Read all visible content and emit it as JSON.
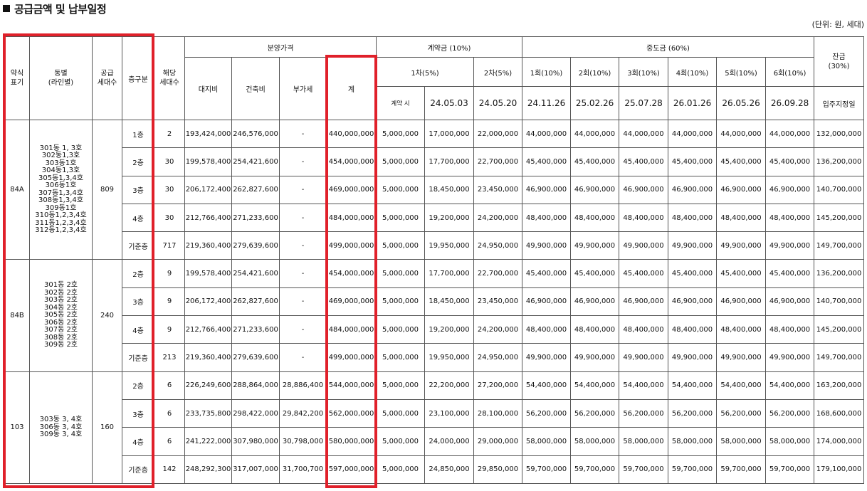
{
  "title": "공급금액 및 납부일정",
  "unit_note": "(단위: 원, 세대)",
  "headers": {
    "type": "약식\n표기",
    "dong": "동별\n(라인별)",
    "supply": "공급\n세대수",
    "floor": "층구분",
    "units": "해당\n세대수",
    "price": "분양가격",
    "land": "대지비",
    "building": "건축비",
    "vat": "부가세",
    "total": "계",
    "contract": "계약금 (10%)",
    "c1": "1차(5%)",
    "c2": "2차(5%)",
    "c1_when": "계약 시",
    "c1_date": "24.05.03",
    "c2_date": "24.05.20",
    "middle": "중도금 (60%)",
    "m1": "1회(10%)",
    "m2": "2회(10%)",
    "m3": "3회(10%)",
    "m4": "4회(10%)",
    "m5": "5회(10%)",
    "m6": "6회(10%)",
    "m1_date": "24.11.26",
    "m2_date": "25.02.26",
    "m3_date": "25.07.28",
    "m4_date": "26.01.26",
    "m5_date": "26.05.26",
    "m6_date": "26.09.28",
    "balance": "잔금\n(30%)",
    "balance_date": "입주지정일"
  },
  "groups": [
    {
      "type": "84A",
      "dong": "301동 1, 3호\n302동1,3호\n303동1호\n304동1,3호\n305동1,3,4호\n306동1호\n307동1,3,4호\n308동1,3,4호\n309동1호\n310동1,2,3,4호\n311동1,2,3,4호\n312동1,2,3,4호",
      "supply": "809",
      "rows": [
        {
          "floor": "1층",
          "units": "2",
          "land": "193,424,000",
          "building": "246,576,000",
          "vat": "-",
          "total": "440,000,000",
          "c1": "5,000,000",
          "c1b": "17,000,000",
          "c2": "22,000,000",
          "m": "44,000,000",
          "bal": "132,000,000"
        },
        {
          "floor": "2층",
          "units": "30",
          "land": "199,578,400",
          "building": "254,421,600",
          "vat": "-",
          "total": "454,000,000",
          "c1": "5,000,000",
          "c1b": "17,700,000",
          "c2": "22,700,000",
          "m": "45,400,000",
          "bal": "136,200,000"
        },
        {
          "floor": "3층",
          "units": "30",
          "land": "206,172,400",
          "building": "262,827,600",
          "vat": "-",
          "total": "469,000,000",
          "c1": "5,000,000",
          "c1b": "18,450,000",
          "c2": "23,450,000",
          "m": "46,900,000",
          "bal": "140,700,000"
        },
        {
          "floor": "4층",
          "units": "30",
          "land": "212,766,400",
          "building": "271,233,600",
          "vat": "-",
          "total": "484,000,000",
          "c1": "5,000,000",
          "c1b": "19,200,000",
          "c2": "24,200,000",
          "m": "48,400,000",
          "bal": "145,200,000"
        },
        {
          "floor": "기준층",
          "units": "717",
          "land": "219,360,400",
          "building": "279,639,600",
          "vat": "-",
          "total": "499,000,000",
          "c1": "5,000,000",
          "c1b": "19,950,000",
          "c2": "24,950,000",
          "m": "49,900,000",
          "bal": "149,700,000"
        }
      ]
    },
    {
      "type": "84B",
      "dong": "301동 2호\n302동 2호\n303동 2호\n304동 2호\n305동 2호\n306동 2호\n307동 2호\n308동 2호\n309동 2호",
      "supply": "240",
      "rows": [
        {
          "floor": "2층",
          "units": "9",
          "land": "199,578,400",
          "building": "254,421,600",
          "vat": "-",
          "total": "454,000,000",
          "c1": "5,000,000",
          "c1b": "17,700,000",
          "c2": "22,700,000",
          "m": "45,400,000",
          "bal": "136,200,000"
        },
        {
          "floor": "3층",
          "units": "9",
          "land": "206,172,400",
          "building": "262,827,600",
          "vat": "-",
          "total": "469,000,000",
          "c1": "5,000,000",
          "c1b": "18,450,000",
          "c2": "23,450,000",
          "m": "46,900,000",
          "bal": "140,700,000"
        },
        {
          "floor": "4층",
          "units": "9",
          "land": "212,766,400",
          "building": "271,233,600",
          "vat": "-",
          "total": "484,000,000",
          "c1": "5,000,000",
          "c1b": "19,200,000",
          "c2": "24,200,000",
          "m": "48,400,000",
          "bal": "145,200,000"
        },
        {
          "floor": "기준층",
          "units": "213",
          "land": "219,360,400",
          "building": "279,639,600",
          "vat": "-",
          "total": "499,000,000",
          "c1": "5,000,000",
          "c1b": "19,950,000",
          "c2": "24,950,000",
          "m": "49,900,000",
          "bal": "149,700,000"
        }
      ]
    },
    {
      "type": "103",
      "dong": "303동 3, 4호\n306동 3, 4호\n309동 3, 4호",
      "supply": "160",
      "rows": [
        {
          "floor": "2층",
          "units": "6",
          "land": "226,249,600",
          "building": "288,864,000",
          "vat": "28,886,400",
          "total": "544,000,000",
          "c1": "5,000,000",
          "c1b": "22,200,000",
          "c2": "27,200,000",
          "m": "54,400,000",
          "bal": "163,200,000"
        },
        {
          "floor": "3층",
          "units": "6",
          "land": "233,735,800",
          "building": "298,422,000",
          "vat": "29,842,200",
          "total": "562,000,000",
          "c1": "5,000,000",
          "c1b": "23,100,000",
          "c2": "28,100,000",
          "m": "56,200,000",
          "bal": "168,600,000"
        },
        {
          "floor": "4층",
          "units": "6",
          "land": "241,222,000",
          "building": "307,980,000",
          "vat": "30,798,000",
          "total": "580,000,000",
          "c1": "5,000,000",
          "c1b": "24,000,000",
          "c2": "29,000,000",
          "m": "58,000,000",
          "bal": "174,000,000"
        },
        {
          "floor": "기준층",
          "units": "142",
          "land": "248,292,300",
          "building": "317,007,000",
          "vat": "31,700,700",
          "total": "597,000,000",
          "c1": "5,000,000",
          "c1b": "24,850,000",
          "c2": "29,850,000",
          "m": "59,700,000",
          "bal": "179,100,000"
        }
      ]
    }
  ]
}
